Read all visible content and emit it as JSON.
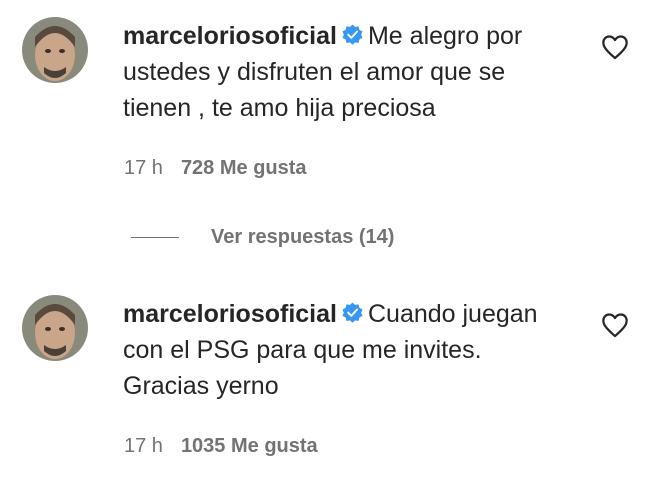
{
  "comments": [
    {
      "username": "marceloriosoficial",
      "text": "Me alegro por ustedes y disfruten el amor que se tienen , te amo hija preciosa",
      "time": "17 h",
      "likes": "728 Me gusta",
      "replies_label": "Ver respuestas (14)"
    },
    {
      "username": "marceloriosoficial",
      "text": "Cuando juegan con el PSG para que me invites. Gracias yerno",
      "time": "17 h",
      "likes": "1035 Me gusta"
    }
  ],
  "colors": {
    "text": "#262626",
    "secondary": "#737373",
    "verified": "#3897f0"
  },
  "icons": [
    "avatar",
    "verified-badge-icon",
    "heart-outline-icon"
  ]
}
